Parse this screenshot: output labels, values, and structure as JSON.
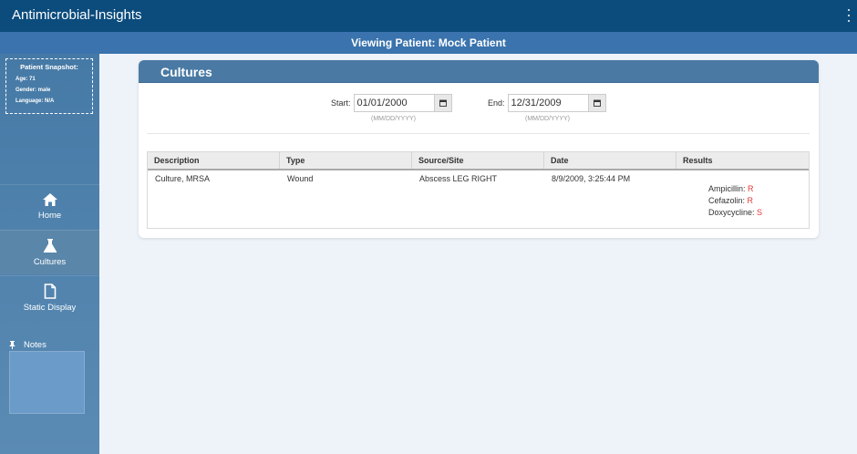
{
  "app": {
    "title": "Antimicrobial-Insights"
  },
  "patient_bar": {
    "text": "Viewing Patient: Mock Patient"
  },
  "snapshot": {
    "title": "Patient Snapshot:",
    "age": "Age: 71",
    "gender": "Gender: male",
    "language": "Language: N/A"
  },
  "nav": [
    {
      "label": "Home",
      "icon": "home-icon",
      "active": false
    },
    {
      "label": "Cultures",
      "icon": "flask-icon",
      "active": true
    },
    {
      "label": "Static Display",
      "icon": "document-icon",
      "active": false
    }
  ],
  "notes": {
    "label": "Notes",
    "icon": "pin-icon",
    "value": ""
  },
  "cultures": {
    "title": "Cultures",
    "start": {
      "label": "Start:",
      "value": "01/01/2000",
      "hint": "(MM/DD/YYYY)"
    },
    "end": {
      "label": "End:",
      "value": "12/31/2009",
      "hint": "(MM/DD/YYYY)"
    },
    "columns": [
      "Description",
      "Type",
      "Source/Site",
      "Date",
      "Results"
    ],
    "rows": [
      {
        "description": "Culture, MRSA",
        "type": "Wound",
        "source": "Abscess LEG RIGHT",
        "date": "8/9/2009, 3:25:44 PM",
        "results": [
          {
            "drug": "Ampicillin:",
            "value": "R"
          },
          {
            "drug": "Cefazolin:",
            "value": "R"
          },
          {
            "drug": "Doxycycline:",
            "value": "S"
          }
        ]
      }
    ]
  },
  "colors": {
    "topbar": "#0c4c7d",
    "patient_bar": "#3a73ad",
    "sidebar": "#467aa6",
    "card_header": "#4a7aa4",
    "resistance": "#e53935"
  }
}
